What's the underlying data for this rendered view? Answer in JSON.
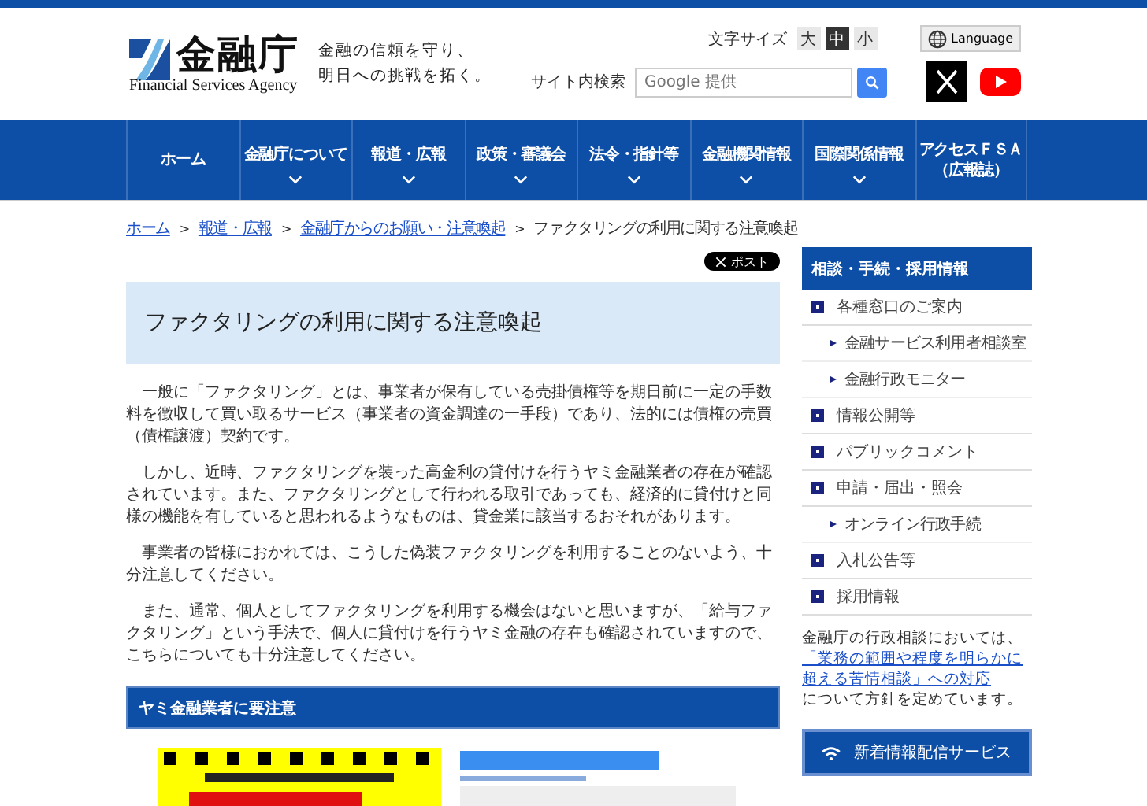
{
  "header": {
    "logo_name": "金融庁",
    "logo_english": "Financial Services Agency",
    "tagline": [
      "金融の信頼を守り、",
      "明日への挑戦を拓く。"
    ],
    "font_size": {
      "label": "文字サイズ",
      "options": [
        {
          "label": "大",
          "selected": false
        },
        {
          "label": "中",
          "selected": true
        },
        {
          "label": "小",
          "selected": false
        }
      ]
    },
    "language": "Language",
    "search": {
      "label": "サイト内検索",
      "placeholder": "Google 提供"
    }
  },
  "nav": [
    {
      "label": "ホーム",
      "dropdown": false
    },
    {
      "label": "金融庁について",
      "dropdown": true
    },
    {
      "label": "報道・広報",
      "dropdown": true
    },
    {
      "label": "政策・審議会",
      "dropdown": true
    },
    {
      "label": "法令・指針等",
      "dropdown": true
    },
    {
      "label": "金融機関情報",
      "dropdown": true
    },
    {
      "label": "国際関係情報",
      "dropdown": true
    },
    {
      "lines": [
        "アクセスＦＳＡ",
        "（広報誌）"
      ],
      "dropdown": false
    }
  ],
  "breadcrumb_separator": ">",
  "breadcrumb": [
    {
      "label": "ホーム",
      "link": true
    },
    {
      "label": "報道・広報",
      "link": true
    },
    {
      "label": "金融庁からのお願い・注意喚起",
      "link": true
    },
    {
      "label": "ファクタリングの利用に関する注意喚起",
      "link": false
    }
  ],
  "share_button": "ポスト",
  "title": "ファクタリングの利用に関する注意喚起",
  "paragraphs": [
    "一般に「ファクタリング」とは、事業者が保有している売掛債権等を期日前に一定の手数料を徴収して買い取るサービス（事業者の資金調達の一手段）であり、法的には債権の売買（債権譲渡）契約です。",
    "しかし、近時、ファクタリングを装った高金利の貸付けを行うヤミ金融業者の存在が確認されています。また、ファクタリングとして行われる取引であっても、経済的に貸付けと同様の機能を有していると思われるようなものは、貸金業に該当するおそれがあります。",
    "事業者の皆様におかれては、こうした偽装ファクタリングを利用することのないよう、十分注意してください。",
    "また、通常、個人としてファクタリングを利用する機会はないと思いますが、「給与ファクタリング」という手法で、個人に貸付けを行うヤミ金融の存在も確認されていますので、こちらについても十分注意してください。"
  ],
  "section_heading": "ヤミ金融業者に要注意",
  "sidebar": {
    "heading": "相談・手続・採用情報",
    "items": [
      {
        "kind": "section",
        "label": "各種窓口のご案内"
      },
      {
        "kind": "sub",
        "label": "金融サービス利用者相談室"
      },
      {
        "kind": "sub",
        "label": "金融行政モニター"
      },
      {
        "kind": "section",
        "label": "情報公開等"
      },
      {
        "kind": "section",
        "label": "パブリックコメント"
      },
      {
        "kind": "section",
        "label": "申請・届出・照会"
      },
      {
        "kind": "sub",
        "label": "オンライン行政手続"
      },
      {
        "kind": "section",
        "label": "入札公告等"
      },
      {
        "kind": "section",
        "label": "採用情報"
      }
    ],
    "note": {
      "before": "金融庁の行政相談においては、",
      "link": "「業務の範囲や程度を明らかに超える苦情相談」への対応",
      "after": "について方針を定めています。"
    },
    "service_button": "新着情報配信サービス"
  }
}
